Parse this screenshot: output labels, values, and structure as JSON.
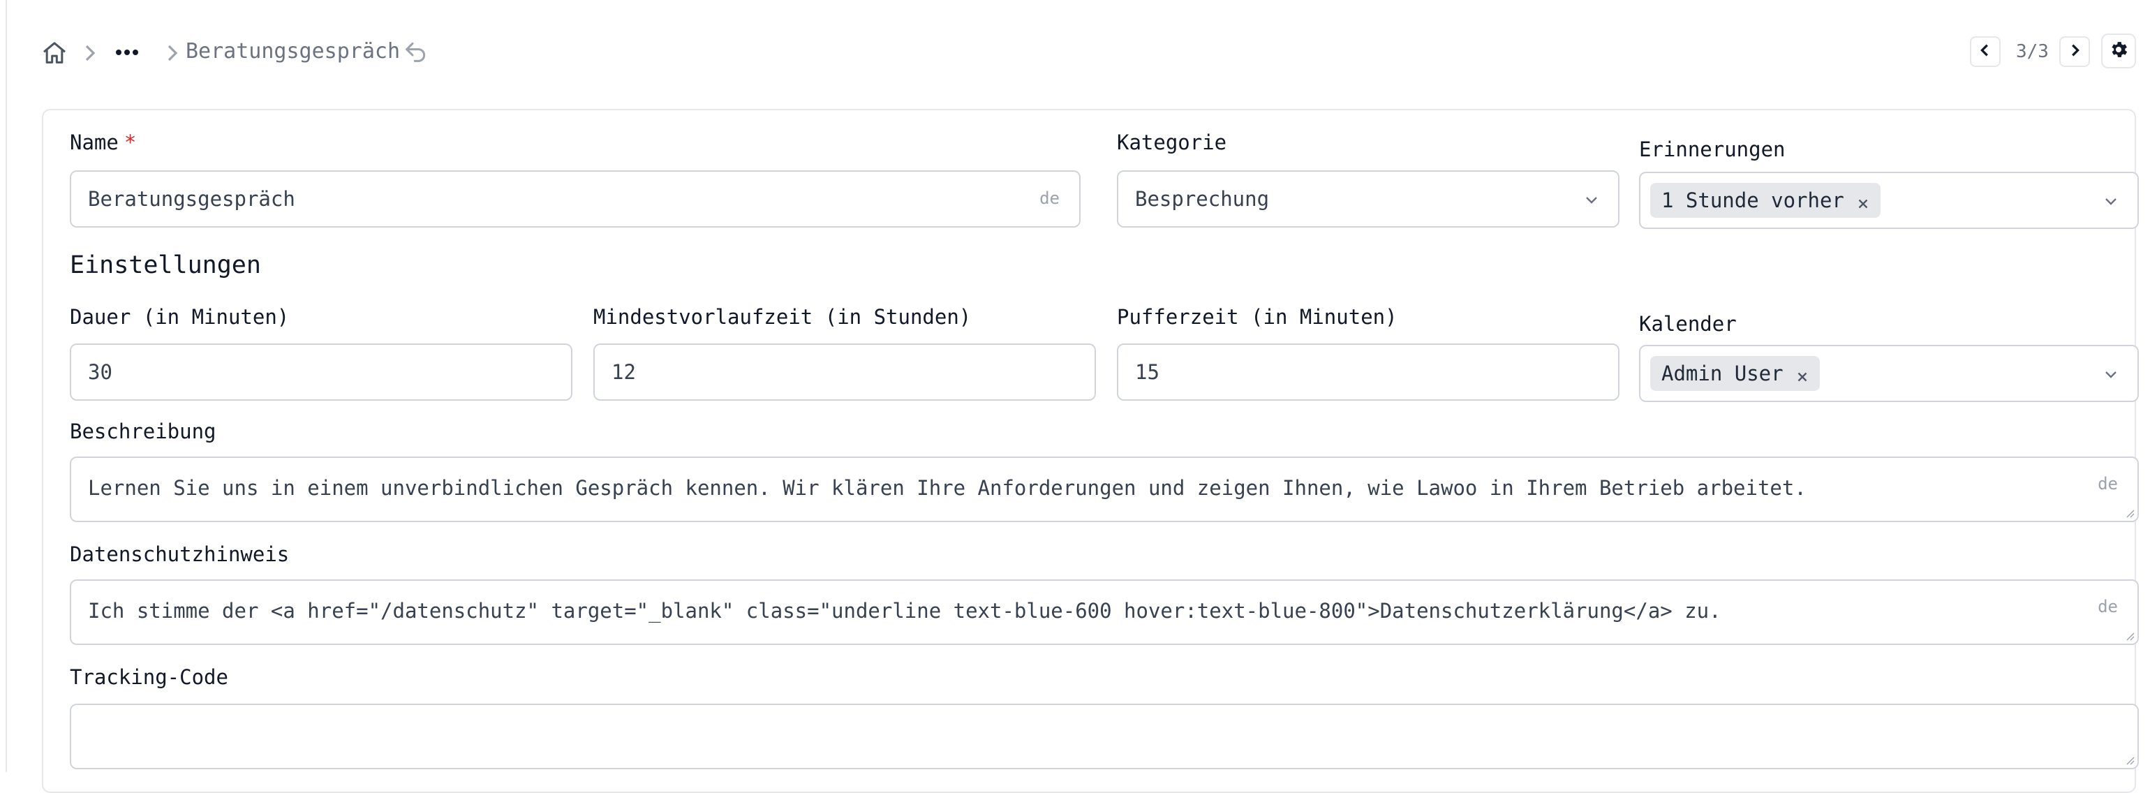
{
  "breadcrumb": {
    "more_label": "•••",
    "current": "Beratungsgespräch"
  },
  "pager": {
    "text": "3/3"
  },
  "form": {
    "name": {
      "label": "Name",
      "required_mark": "*",
      "value": "Beratungsgespräch",
      "lang": "de"
    },
    "kategorie": {
      "label": "Kategorie",
      "value": "Besprechung"
    },
    "erinnerungen": {
      "label": "Erinnerungen",
      "chip": "1 Stunde vorher"
    },
    "section_title": "Einstellungen",
    "dauer": {
      "label": "Dauer (in Minuten)",
      "value": "30"
    },
    "vorlauf": {
      "label": "Mindestvorlaufzeit (in Stunden)",
      "value": "12"
    },
    "puffer": {
      "label": "Pufferzeit (in Minuten)",
      "value": "15"
    },
    "kalender": {
      "label": "Kalender",
      "chip": "Admin User"
    },
    "beschreibung": {
      "label": "Beschreibung",
      "value": "Lernen Sie uns in einem unverbindlichen Gespräch kennen. Wir klären Ihre Anforderungen und zeigen Ihnen, wie Lawoo in Ihrem Betrieb arbeitet.",
      "lang": "de"
    },
    "datenschutz": {
      "label": "Datenschutzhinweis",
      "value": "Ich stimme der <a href=\"/datenschutz\" target=\"_blank\" class=\"underline text-blue-600 hover:text-blue-800\">Datenschutzerklärung</a> zu.",
      "lang": "de"
    },
    "tracking": {
      "label": "Tracking-Code",
      "value": ""
    }
  },
  "colors": {
    "required": "#dc2626",
    "border": "#d1d5db",
    "chip_bg": "#e5e7eb"
  },
  "icons": [
    "home-icon",
    "chevron-right-icon",
    "more-icon",
    "undo-icon",
    "chevron-left-icon",
    "gear-icon",
    "chevron-down-icon",
    "close-icon"
  ]
}
